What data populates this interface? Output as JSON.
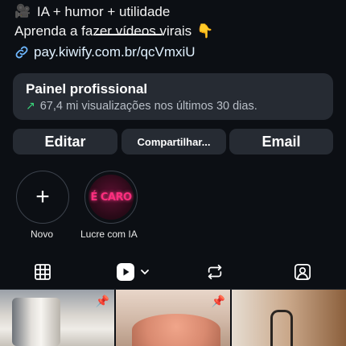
{
  "bio": {
    "line1_icon": "video-camera-icon",
    "line1": "IA + humor + utilidade",
    "line2": "Aprenda a fazer vídeos virais",
    "line2_emoji": "👇"
  },
  "link": {
    "icon": "link-icon",
    "text": "pay.kiwify.com.br/qcVmxiU"
  },
  "panel": {
    "title": "Painel profissional",
    "subtitle": "67,4 mi visualizações nos últimos 30 dias.",
    "trend_color": "#39d67b"
  },
  "buttons": {
    "edit": "Editar",
    "share": "Compartilhar...",
    "email": "Email"
  },
  "highlights": [
    {
      "label": "Novo",
      "icon": "plus-icon"
    },
    {
      "label": "Lucre com IA",
      "cover_text": "É CARO"
    }
  ],
  "tabs": [
    {
      "name": "grid",
      "icon": "grid-icon"
    },
    {
      "name": "reels",
      "icon": "reels-icon",
      "active": true
    },
    {
      "name": "reposts",
      "icon": "repost-icon"
    },
    {
      "name": "tagged",
      "icon": "tagged-icon"
    }
  ],
  "grid": [
    {
      "pinned": true
    },
    {
      "pinned": true
    },
    {
      "pinned": false
    }
  ]
}
